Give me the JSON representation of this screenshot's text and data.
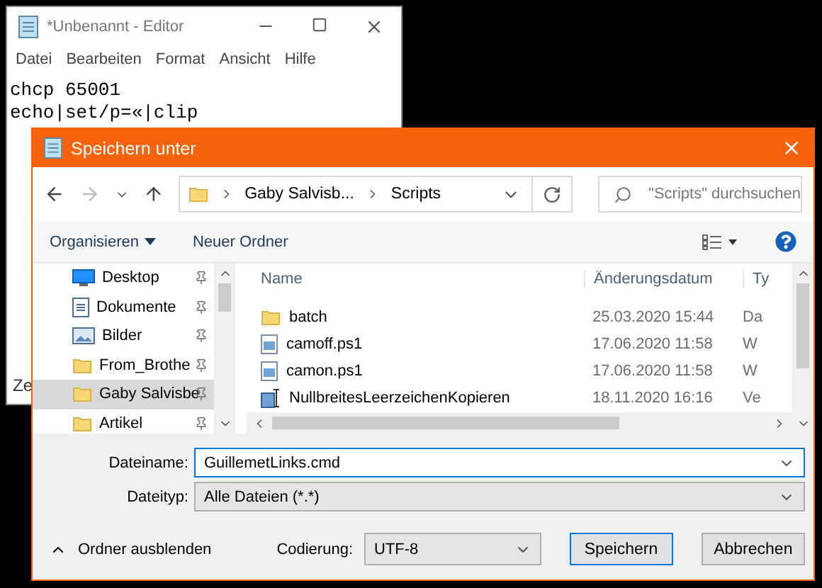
{
  "notepad": {
    "title": "*Unbenannt - Editor",
    "menu": [
      "Datei",
      "Bearbeiten",
      "Format",
      "Ansicht",
      "Hilfe"
    ],
    "lines": [
      "chcp 65001",
      "echo|set/p=«|clip"
    ],
    "status": "Ze"
  },
  "dialog": {
    "title": "Speichern unter",
    "breadcrumb": [
      "Gaby Salvisb...",
      "Scripts"
    ],
    "search": {
      "placeholder": "\"Scripts\" durchsuchen"
    },
    "toolbar": {
      "organize": "Organisieren",
      "new_folder": "Neuer Ordner"
    },
    "nav": [
      {
        "label": "Desktop",
        "kind": "desktop",
        "selected": false
      },
      {
        "label": "Dokumente",
        "kind": "documents",
        "selected": false
      },
      {
        "label": "Bilder",
        "kind": "pictures",
        "selected": false
      },
      {
        "label": "From_Brothe",
        "kind": "folder",
        "selected": false
      },
      {
        "label": "Gaby Salvisbe",
        "kind": "folder",
        "selected": true
      },
      {
        "label": "Artikel",
        "kind": "folder",
        "selected": false
      }
    ],
    "columns": [
      "Name",
      "Änderungsdatum",
      "Ty"
    ],
    "files": [
      {
        "name": "batch",
        "kind": "folder",
        "date": "25.03.2020 15:44",
        "type": "Da"
      },
      {
        "name": "camoff.ps1",
        "kind": "script",
        "date": "17.06.2020 11:58",
        "type": "W"
      },
      {
        "name": "camon.ps1",
        "kind": "script",
        "date": "17.06.2020 11:58",
        "type": "W"
      },
      {
        "name": "NullbreitesLeerzeichenKopieren",
        "kind": "shortcut",
        "date": "18.11.2020 16:16",
        "type": "Ve"
      }
    ],
    "filename_label": "Dateiname:",
    "filename": "GuillemetLinks.cmd",
    "filetype_label": "Dateityp:",
    "filetype": "Alle Dateien  (*.*)",
    "hide_folders": "Ordner ausblenden",
    "encoding_label": "Codierung:",
    "encoding": "UTF-8",
    "buttons": [
      "Speichern",
      "Abbrechen"
    ]
  }
}
